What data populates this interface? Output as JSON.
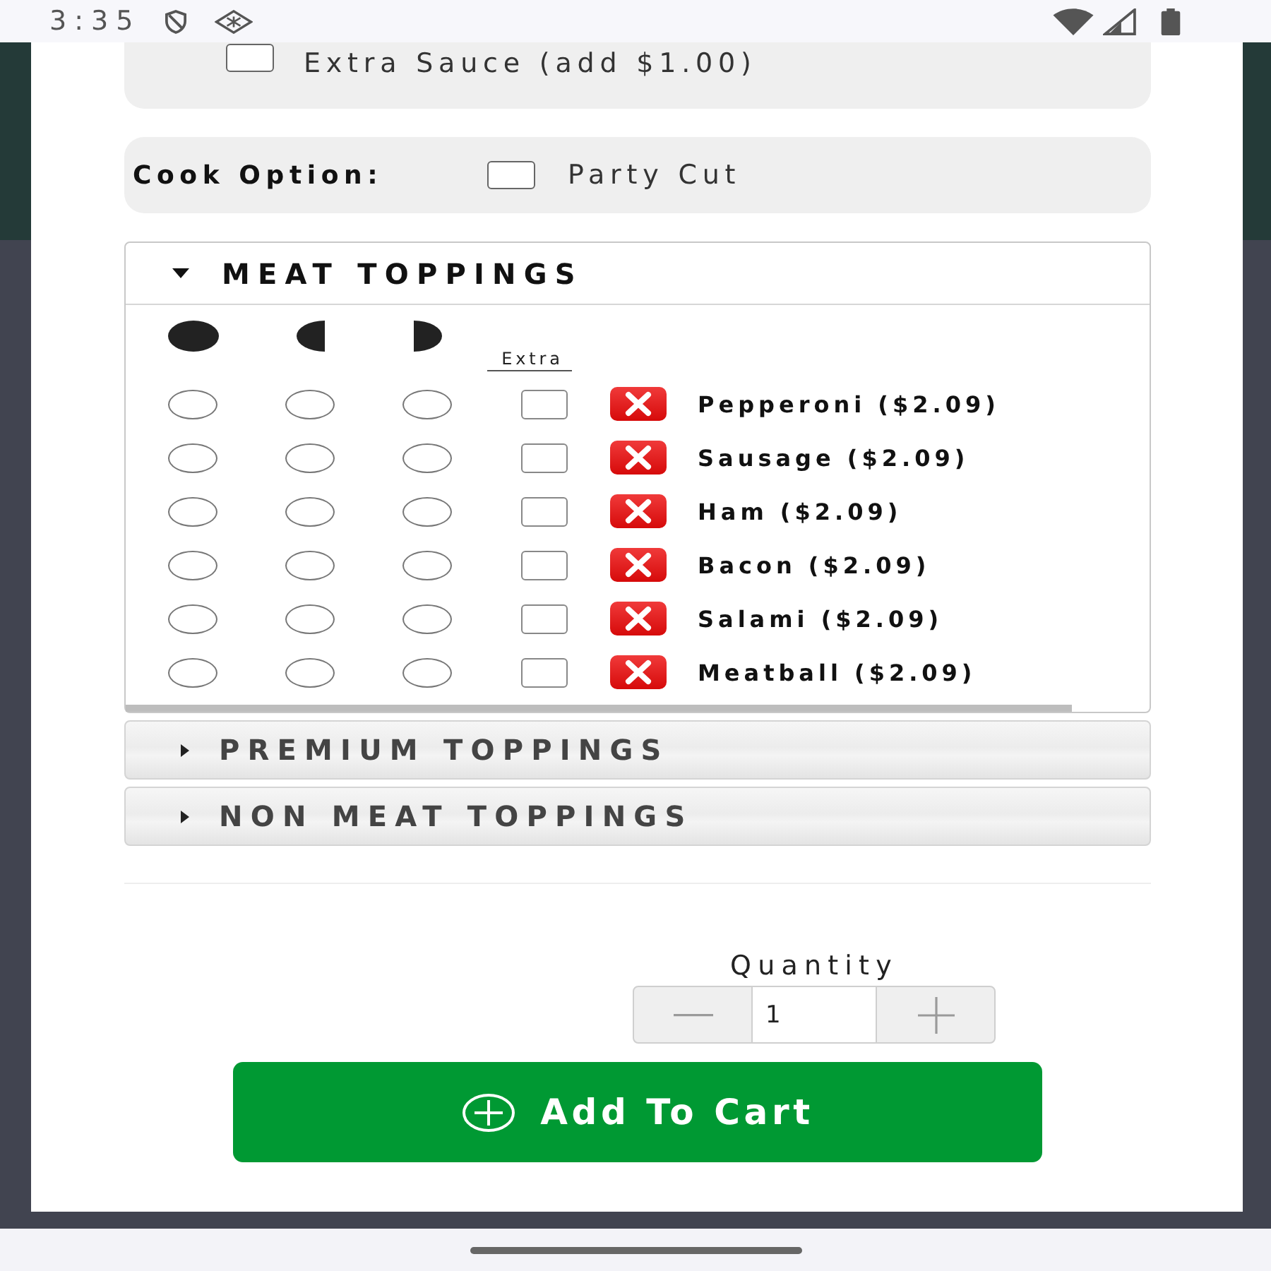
{
  "status_bar": {
    "time": "3:35"
  },
  "extras": [
    {
      "label": "Extra Sauce (add $1.00)",
      "checked": false
    }
  ],
  "cook_option": {
    "label": "Cook Option:",
    "options": [
      {
        "label": "Party Cut",
        "checked": false
      }
    ]
  },
  "topping_sections": [
    {
      "title": "MEAT TOPPINGS",
      "expanded": true,
      "extra_label": "Extra",
      "items": [
        {
          "name": "Pepperoni ($2.09)",
          "portions": [
            {
              "selected": false
            },
            {
              "selected": false
            },
            {
              "selected": false
            }
          ],
          "extra": false
        },
        {
          "name": "Sausage ($2.09)",
          "portions": [
            {
              "selected": false
            },
            {
              "selected": false
            },
            {
              "selected": false
            }
          ],
          "extra": false
        },
        {
          "name": "Ham ($2.09)",
          "portions": [
            {
              "selected": false
            },
            {
              "selected": false
            },
            {
              "selected": false
            }
          ],
          "extra": false
        },
        {
          "name": "Bacon ($2.09)",
          "portions": [
            {
              "selected": false
            },
            {
              "selected": false
            },
            {
              "selected": false
            }
          ],
          "extra": false
        },
        {
          "name": "Salami ($2.09)",
          "portions": [
            {
              "selected": false
            },
            {
              "selected": false
            },
            {
              "selected": false
            }
          ],
          "extra": false
        },
        {
          "name": "Meatball ($2.09)",
          "portions": [
            {
              "selected": false
            },
            {
              "selected": false
            },
            {
              "selected": false
            }
          ],
          "extra": false
        }
      ]
    },
    {
      "title": "PREMIUM TOPPINGS",
      "expanded": false
    },
    {
      "title": "NON MEAT TOPPINGS",
      "expanded": false
    }
  ],
  "quantity": {
    "label": "Quantity",
    "value": "1"
  },
  "add_to_cart": {
    "label": "Add To Cart"
  }
}
